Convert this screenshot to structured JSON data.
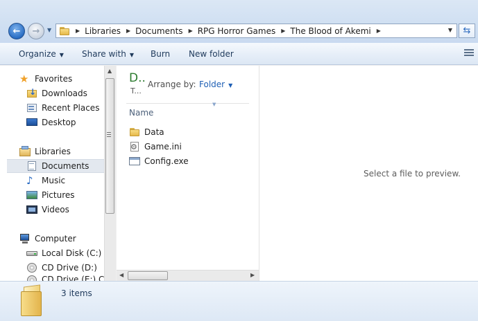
{
  "address": {
    "crumbs": [
      "Libraries",
      "Documents",
      "RPG Horror Games",
      "The Blood of Akemi"
    ]
  },
  "toolbar": {
    "organize": "Organize",
    "share_with": "Share with",
    "burn": "Burn",
    "new_folder": "New folder"
  },
  "sidebar": {
    "favorites": {
      "label": "Favorites",
      "items": [
        "Downloads",
        "Recent Places",
        "Desktop"
      ]
    },
    "libraries": {
      "label": "Libraries",
      "items": [
        "Documents",
        "Music",
        "Pictures",
        "Videos"
      ],
      "selected": "Documents"
    },
    "computer": {
      "label": "Computer",
      "items": [
        "Local Disk (C:)",
        "CD Drive (D:)",
        "CD Drive (E:) Cl"
      ]
    }
  },
  "library_header": {
    "title": "D..",
    "subtitle": "T...",
    "arrange_label": "Arrange by:",
    "arrange_value": "Folder"
  },
  "columns": {
    "name": "Name"
  },
  "files": [
    {
      "name": "Data",
      "type": "folder"
    },
    {
      "name": "Game.ini",
      "type": "ini"
    },
    {
      "name": "Config.exe",
      "type": "exe"
    }
  ],
  "preview": {
    "empty_text": "Select a file to preview."
  },
  "details": {
    "item_count": "3 items"
  }
}
